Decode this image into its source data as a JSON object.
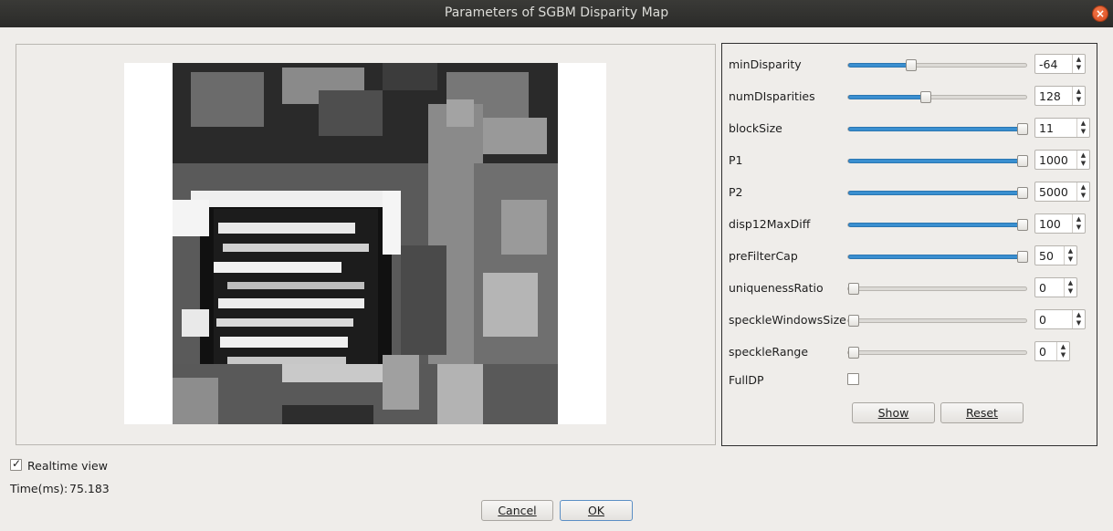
{
  "window": {
    "title": "Parameters of SGBM Disparity Map",
    "close_glyph": "×"
  },
  "params": [
    {
      "label": "minDisparity",
      "value": "-64",
      "level": 0.35
    },
    {
      "label": "numDIsparities",
      "value": "128",
      "level": 0.43
    },
    {
      "label": "blockSize",
      "value": "11",
      "level": 1.0
    },
    {
      "label": "P1",
      "value": "1000",
      "level": 1.0
    },
    {
      "label": "P2",
      "value": "5000",
      "level": 1.0
    },
    {
      "label": "disp12MaxDiff",
      "value": "100",
      "level": 1.0
    },
    {
      "label": "preFilterCap",
      "value": "50",
      "level": 1.0
    },
    {
      "label": "uniquenessRatio",
      "value": "0",
      "level": 0.0
    },
    {
      "label": "speckleWindowsSize",
      "value": "0",
      "level": 0.0
    },
    {
      "label": "speckleRange",
      "value": "0",
      "level": 0.0
    }
  ],
  "fulldp": {
    "label": "FullDP",
    "checked": false
  },
  "buttons": {
    "show": "Show",
    "reset": "Reset",
    "cancel": "Cancel",
    "ok": "OK"
  },
  "realtime": {
    "label": "Realtime view",
    "checked": true
  },
  "time": {
    "prefix": "Time(ms):",
    "value": "75.183"
  },
  "colors": {
    "accent": "#3a8fd0",
    "titlebar": "#2b2b29",
    "background": "#efedea",
    "close": "#e05a26"
  }
}
